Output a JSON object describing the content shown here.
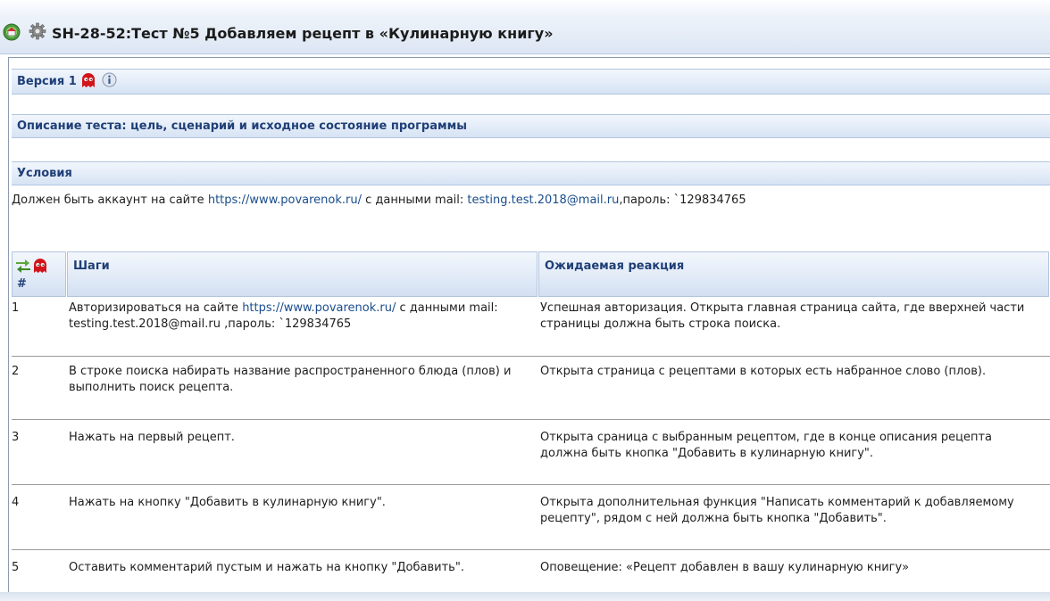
{
  "header": {
    "title": "SH-28-52:Тест №5 Добавляем рецепт в «Кулинарную книгу»"
  },
  "sections": {
    "version": "Версия 1",
    "description": "Описание теста: цель, сценарий и исходное состояние программы",
    "conditions": "Условия"
  },
  "conditions": {
    "prefix": "Должен быть аккаунт на сайте",
    "site_link": "https://www.povarenok.ru/",
    "middle": "с данными mail:",
    "email_link": "testing.test.2018@mail.ru",
    "suffix": ",пароль: `129834765"
  },
  "table": {
    "col_num": "#",
    "col_steps": "Шаги",
    "col_expected": "Ожидаемая реакция",
    "rows": [
      {
        "num": "1",
        "step_prefix": "Авторизироваться на сайте",
        "step_link": "https://www.povarenok.ru/",
        "step_suffix": "с данными mail: testing.test.2018@mail.ru  ,пароль: `129834765",
        "expected": "Успешная авторизация. Открыта главная страница сайта, где вверхней части страницы должна быть строка поиска."
      },
      {
        "num": "2",
        "step": "В строке поиска набирать название распространенного блюда (плов)  и выполнить поиск рецепта.",
        "expected": "Открыта страница с рецептами в которых есть набранное слово (плов)."
      },
      {
        "num": "3",
        "step": "Нажать на первый рецепт.",
        "expected": "Открыта сраница с выбранным рецептом, где в конце описания рецепта должна быть кнопка \"Добавить в кулинарную книгу\"."
      },
      {
        "num": "4",
        "step": "Нажать на кнопку \"Добавить в кулинарную книгу\".",
        "expected": "Открыта дополнительная функция \"Написать комментарий к добавляемому рецепту\", рядом с ней должна быть кнопка \"Добавить\"."
      },
      {
        "num": "5",
        "step": "Оставить комментарий пустым и нажать на кнопку \"Добавить\".",
        "expected": "Оповещение: «Рецепт добавлен в вашу кулинарную книгу»"
      }
    ]
  },
  "icons": {
    "home": "home-icon",
    "settings": "gear-icon",
    "ghost": "ghost-icon",
    "info": "info-icon",
    "reorder": "reorder-arrows-icon"
  },
  "colors": {
    "ghost": "#d2151b",
    "link": "#1a4d8c",
    "section_text": "#1f3f77"
  }
}
